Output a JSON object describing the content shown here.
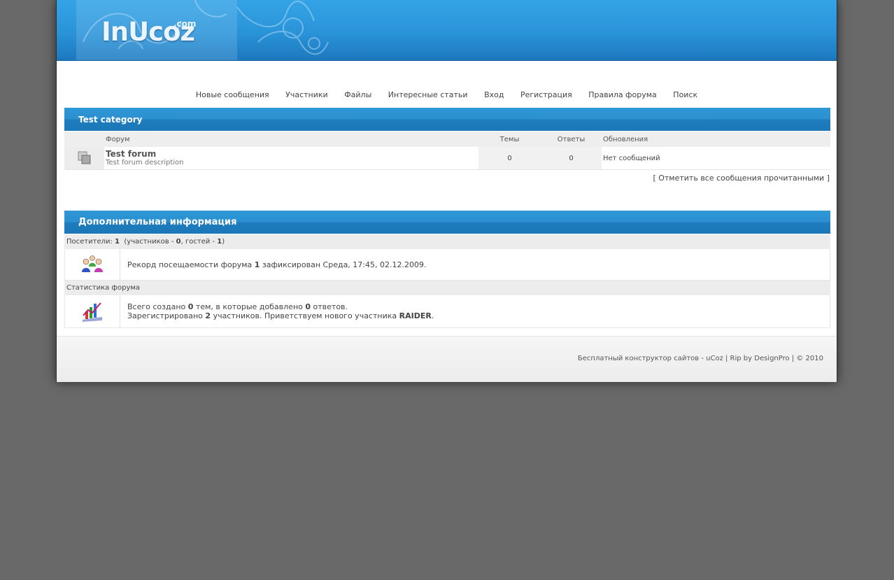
{
  "header": {
    "logo_text": "InUcoz",
    "logo_suffix": ".com"
  },
  "nav": [
    "Новые сообщения",
    "Участники",
    "Файлы",
    "Интересные статьи",
    "Вход",
    "Регистрация",
    "Правила форума",
    "Поиск"
  ],
  "category": {
    "title": "Test category",
    "columns": {
      "forum": "Форум",
      "themes": "Темы",
      "replies": "Ответы",
      "updates": "Обновления"
    },
    "forums": [
      {
        "title": "Test forum",
        "description": "Test forum description",
        "themes": "0",
        "replies": "0",
        "updates": "Нет сообщений"
      }
    ],
    "mark_read": "[ Отметить все сообщения прочитанными ]"
  },
  "info": {
    "title": "Дополнительная информация",
    "visitors_label": "Посетители:",
    "visitors_total": "1",
    "visitors_members_label": "(участников -",
    "visitors_members": "0",
    "visitors_guests_label": ", гостей -",
    "visitors_guests": "1",
    "record_prefix": "Рекорд посещаемости форума",
    "record_count": "1",
    "record_suffix": "зафиксирован Среда, 17:45, 02.12.2009.",
    "stats_label": "Статистика форума",
    "stats_prefix": "Всего создано",
    "stats_topics": "0",
    "stats_mid": "тем, в которые добавлено",
    "stats_posts": "0",
    "stats_suffix": "ответов.",
    "reg_prefix": "Зарегистрировано",
    "reg_count": "2",
    "reg_mid": "участников. Приветствуем нового участника",
    "reg_user": "RAIDER",
    "reg_end": "."
  },
  "footer": {
    "copyright": "Бесплатный конструктор сайтов - uCoz | Rip by DesignPro | © 2010"
  },
  "colors": {
    "accent": "#2a93d8",
    "background": "#696969"
  }
}
